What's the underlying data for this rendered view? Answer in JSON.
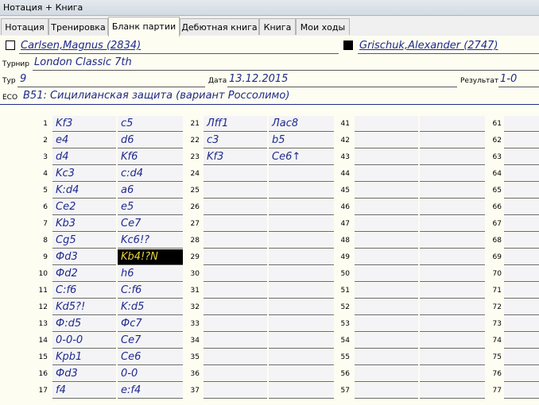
{
  "window": {
    "title": "Нотация + Книга"
  },
  "tabs": [
    {
      "label": "Нотация",
      "active": false
    },
    {
      "label": "Тренировка",
      "active": false
    },
    {
      "label": "Бланк партии",
      "active": true
    },
    {
      "label": "Дебютная книга",
      "active": false
    },
    {
      "label": "Книга",
      "active": false
    },
    {
      "label": "Мои ходы",
      "active": false
    }
  ],
  "header": {
    "white_player": "Carlsen,Magnus (2834)",
    "black_player": "Grischuk,Alexander (2747)",
    "tournament_label": "Турнир",
    "tournament": "London Classic 7th",
    "round_label": "Тур",
    "round": "9",
    "date_label": "Дата",
    "date": "13.12.2015",
    "result_label": "Результат",
    "result": "1-0",
    "eco_label": "ECO",
    "eco": "B51: Сицилианская защита (вариант Россолимо)"
  },
  "moves": [
    {
      "n": "1",
      "w": "Kf3",
      "b": "c5"
    },
    {
      "n": "2",
      "w": "e4",
      "b": "d6"
    },
    {
      "n": "3",
      "w": "d4",
      "b": "Kf6"
    },
    {
      "n": "4",
      "w": "Kc3",
      "b": "c:d4"
    },
    {
      "n": "5",
      "w": "K:d4",
      "b": "a6"
    },
    {
      "n": "6",
      "w": "Ce2",
      "b": "e5"
    },
    {
      "n": "7",
      "w": "Kb3",
      "b": "Ce7"
    },
    {
      "n": "8",
      "w": "Cg5",
      "b": "Kc6!?"
    },
    {
      "n": "9",
      "w": "Фd3",
      "b": "Kb4!?N"
    },
    {
      "n": "10",
      "w": "Фd2",
      "b": "h6"
    },
    {
      "n": "11",
      "w": "C:f6",
      "b": "C:f6"
    },
    {
      "n": "12",
      "w": "Kd5?!",
      "b": "K:d5"
    },
    {
      "n": "13",
      "w": "Ф:d5",
      "b": "Фc7"
    },
    {
      "n": "14",
      "w": "0-0-0",
      "b": "Ce7"
    },
    {
      "n": "15",
      "w": "Kpb1",
      "b": "Ce6"
    },
    {
      "n": "16",
      "w": "Фd3",
      "b": "0-0"
    },
    {
      "n": "17",
      "w": "f4",
      "b": "e:f4"
    },
    {
      "n": "21",
      "w": "Лff1",
      "b": "Лac8"
    },
    {
      "n": "22",
      "w": "c3",
      "b": "b5"
    },
    {
      "n": "23",
      "w": "Kf3",
      "b": "Ce6↑"
    },
    {
      "n": "24",
      "w": "",
      "b": ""
    },
    {
      "n": "25",
      "w": "",
      "b": ""
    },
    {
      "n": "26",
      "w": "",
      "b": ""
    },
    {
      "n": "27",
      "w": "",
      "b": ""
    },
    {
      "n": "28",
      "w": "",
      "b": ""
    },
    {
      "n": "29",
      "w": "",
      "b": ""
    },
    {
      "n": "30",
      "w": "",
      "b": ""
    },
    {
      "n": "31",
      "w": "",
      "b": ""
    },
    {
      "n": "32",
      "w": "",
      "b": ""
    },
    {
      "n": "33",
      "w": "",
      "b": ""
    },
    {
      "n": "34",
      "w": "",
      "b": ""
    },
    {
      "n": "35",
      "w": "",
      "b": ""
    },
    {
      "n": "36",
      "w": "",
      "b": ""
    },
    {
      "n": "37",
      "w": "",
      "b": ""
    },
    {
      "n": "41",
      "w": "",
      "b": ""
    },
    {
      "n": "42",
      "w": "",
      "b": ""
    },
    {
      "n": "43",
      "w": "",
      "b": ""
    },
    {
      "n": "44",
      "w": "",
      "b": ""
    },
    {
      "n": "45",
      "w": "",
      "b": ""
    },
    {
      "n": "46",
      "w": "",
      "b": ""
    },
    {
      "n": "47",
      "w": "",
      "b": ""
    },
    {
      "n": "48",
      "w": "",
      "b": ""
    },
    {
      "n": "49",
      "w": "",
      "b": ""
    },
    {
      "n": "50",
      "w": "",
      "b": ""
    },
    {
      "n": "51",
      "w": "",
      "b": ""
    },
    {
      "n": "52",
      "w": "",
      "b": ""
    },
    {
      "n": "53",
      "w": "",
      "b": ""
    },
    {
      "n": "54",
      "w": "",
      "b": ""
    },
    {
      "n": "55",
      "w": "",
      "b": ""
    },
    {
      "n": "56",
      "w": "",
      "b": ""
    },
    {
      "n": "57",
      "w": "",
      "b": ""
    },
    {
      "n": "61",
      "w": "",
      "b": ""
    },
    {
      "n": "62",
      "w": "",
      "b": ""
    },
    {
      "n": "63",
      "w": "",
      "b": ""
    },
    {
      "n": "64",
      "w": "",
      "b": ""
    },
    {
      "n": "65",
      "w": "",
      "b": ""
    },
    {
      "n": "66",
      "w": "",
      "b": ""
    },
    {
      "n": "67",
      "w": "",
      "b": ""
    },
    {
      "n": "68",
      "w": "",
      "b": ""
    },
    {
      "n": "69",
      "w": "",
      "b": ""
    },
    {
      "n": "70",
      "w": "",
      "b": ""
    },
    {
      "n": "71",
      "w": "",
      "b": ""
    },
    {
      "n": "72",
      "w": "",
      "b": ""
    },
    {
      "n": "73",
      "w": "",
      "b": ""
    },
    {
      "n": "74",
      "w": "",
      "b": ""
    },
    {
      "n": "75",
      "w": "",
      "b": ""
    },
    {
      "n": "76",
      "w": "",
      "b": ""
    },
    {
      "n": "77",
      "w": "",
      "b": ""
    }
  ],
  "selected_move": {
    "n": "9",
    "side": "b"
  },
  "colors": {
    "move_text": "#1f2a8c",
    "selected_bg": "#000000",
    "selected_text": "#e8d23a",
    "sheet_bg": "#fdfdf2"
  }
}
